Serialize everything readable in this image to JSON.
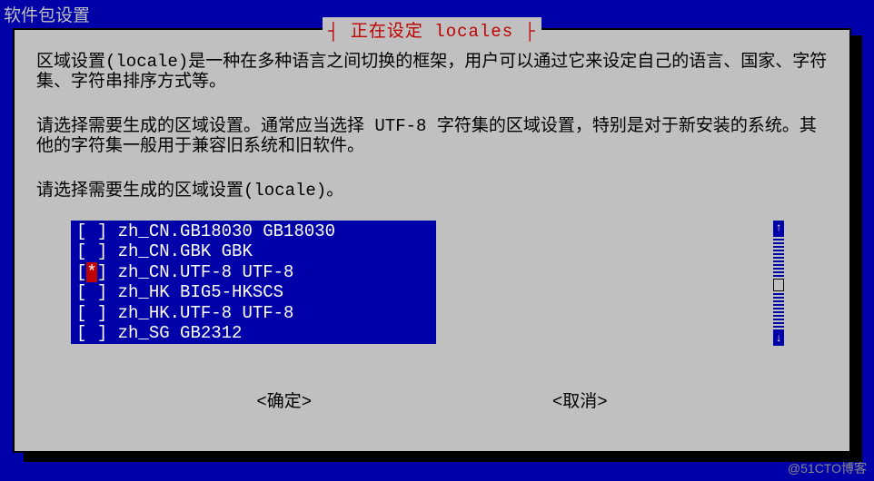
{
  "window": {
    "title": "软件包设置"
  },
  "dialog": {
    "title": "正在设定 locales",
    "description_line1": "区域设置(locale)是一种在多种语言之间切换的框架，用户可以通过它来设定自己的语言、国家、字符集、字符串排序方式等。",
    "description_line2": "请选择需要生成的区域设置。通常应当选择 UTF-8 字符集的区域设置，特别是对于新安装的系统。其他的字符集一般用于兼容旧系统和旧软件。",
    "description_line3": "请选择需要生成的区域设置(locale)。"
  },
  "locales": [
    {
      "checked": false,
      "label": "zh_CN.GB18030 GB18030"
    },
    {
      "checked": false,
      "label": "zh_CN.GBK GBK"
    },
    {
      "checked": true,
      "label": "zh_CN.UTF-8 UTF-8"
    },
    {
      "checked": false,
      "label": "zh_HK BIG5-HKSCS"
    },
    {
      "checked": false,
      "label": "zh_HK.UTF-8 UTF-8"
    },
    {
      "checked": false,
      "label": "zh_SG GB2312"
    }
  ],
  "buttons": {
    "ok": "<确定>",
    "cancel": "<取消>"
  },
  "scrollbar": {
    "up": "↑",
    "down": "↓"
  },
  "watermark": "@51CTO博客"
}
